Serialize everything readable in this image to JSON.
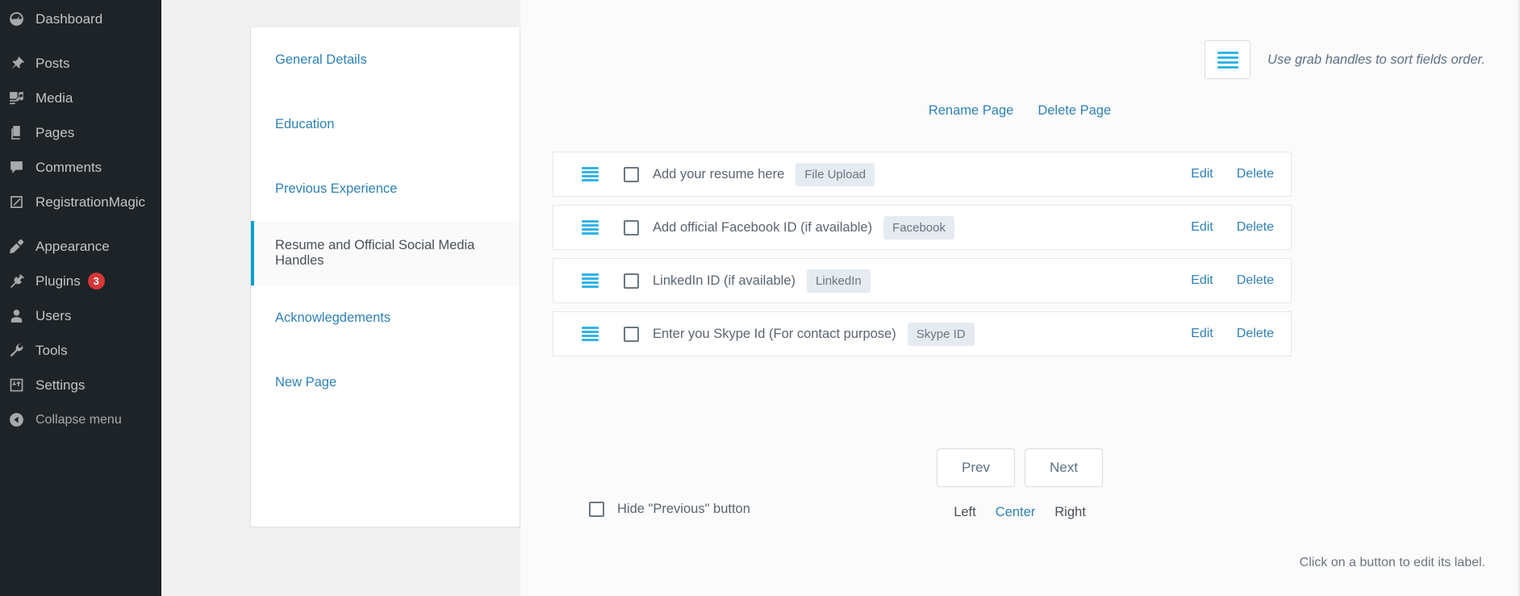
{
  "sidebar": {
    "items": [
      {
        "label": "Dashboard",
        "icon": "dashboard-icon",
        "gap_after": true
      },
      {
        "label": "Posts",
        "icon": "pin-icon"
      },
      {
        "label": "Media",
        "icon": "media-icon"
      },
      {
        "label": "Pages",
        "icon": "pages-icon"
      },
      {
        "label": "Comments",
        "icon": "comments-icon"
      },
      {
        "label": "RegistrationMagic",
        "icon": "registrationmagic-icon",
        "gap_after": true
      },
      {
        "label": "Appearance",
        "icon": "brush-icon"
      },
      {
        "label": "Plugins",
        "icon": "plug-icon",
        "badge": "3"
      },
      {
        "label": "Users",
        "icon": "users-icon"
      },
      {
        "label": "Tools",
        "icon": "wrench-icon"
      },
      {
        "label": "Settings",
        "icon": "settings-icon"
      }
    ],
    "collapse": {
      "label": "Collapse menu",
      "icon": "collapse-arrow-icon"
    }
  },
  "page_list": {
    "items": [
      {
        "label": "General Details",
        "active": false
      },
      {
        "label": "Education",
        "active": false
      },
      {
        "label": "Previous Experience",
        "active": false
      },
      {
        "label": "Resume and Official Social Media Handles",
        "active": true
      },
      {
        "label": "Acknowlegdements",
        "active": false
      },
      {
        "label": "New Page",
        "active": false
      }
    ]
  },
  "content": {
    "sort_legend": "Use grab handles to sort fields order.",
    "sort_handle_icon": "grab-handle-icon",
    "page_actions": {
      "rename": "Rename Page",
      "delete": "Delete Page"
    },
    "fields": [
      {
        "handle_icon": "grab-handle-icon",
        "label": "Add your resume here",
        "type": "File Upload",
        "edit": "Edit",
        "delete": "Delete",
        "checked": false
      },
      {
        "handle_icon": "grab-handle-icon",
        "label": "Add official Facebook ID (if available)",
        "type": "Facebook",
        "edit": "Edit",
        "delete": "Delete",
        "checked": false
      },
      {
        "handle_icon": "grab-handle-icon",
        "label": "LinkedIn ID (if available)",
        "type": "LinkedIn",
        "edit": "Edit",
        "delete": "Delete",
        "checked": false
      },
      {
        "handle_icon": "grab-handle-icon",
        "label": "Enter you Skype Id (For contact purpose)",
        "type": "Skype ID",
        "edit": "Edit",
        "delete": "Delete",
        "checked": false
      }
    ],
    "nav": {
      "prev": "Prev",
      "next": "Next"
    },
    "hide_previous": {
      "label": "Hide \"Previous\" button",
      "checked": false
    },
    "alignment": {
      "options": [
        "Left",
        "Center",
        "Right"
      ],
      "selected": "Center"
    },
    "footer_hint": "Click on a button to edit its label."
  },
  "colors": {
    "accent_blue": "#2f81b7",
    "handle_cyan": "#33b4e8",
    "active_bar": "#00a0d2",
    "badge_red": "#d63638",
    "sidebar_bg": "#1d2327"
  }
}
